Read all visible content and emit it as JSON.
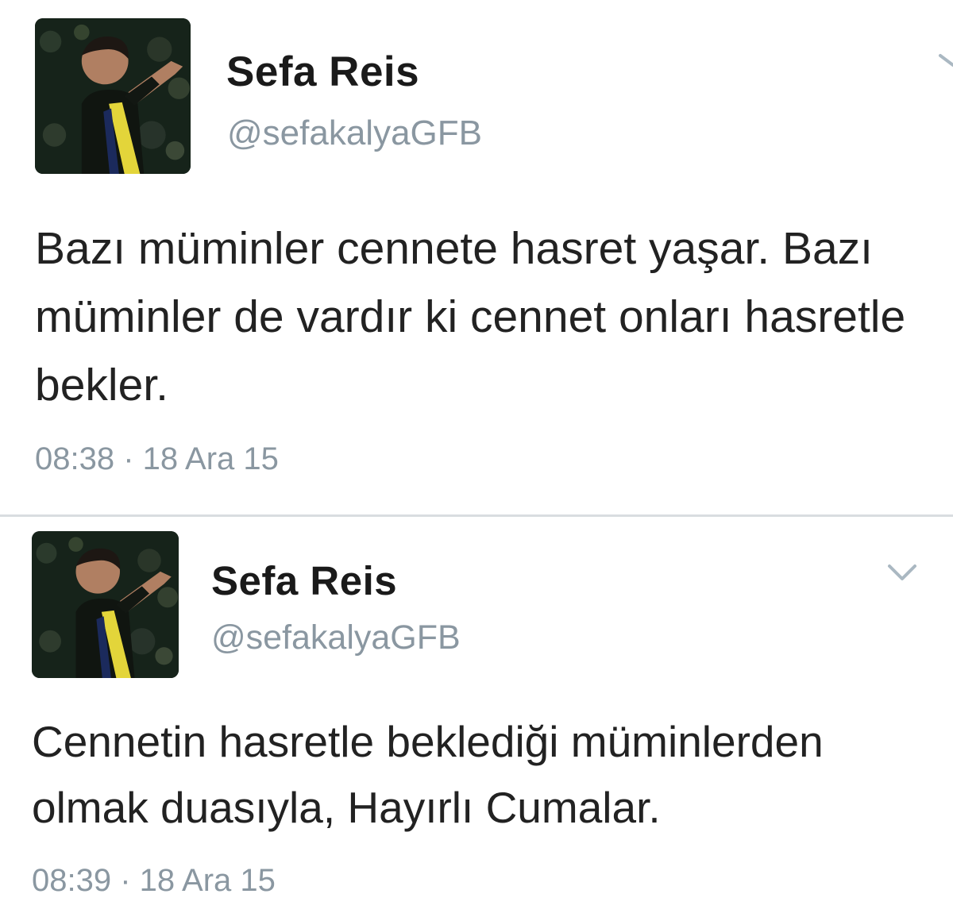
{
  "tweets": [
    {
      "display_name": "Sefa Reis",
      "handle": "@sefakalyaGFB",
      "text": "Bazı müminler cennete hasret yaşar. Bazı müminler de vardır ki cennet onları hasretle bekler.",
      "timestamp": "08:38 · 18 Ara 15"
    },
    {
      "display_name": "Sefa Reis",
      "handle": "@sefakalyaGFB",
      "text": "Cennetin hasretle beklediği müminlerden olmak duasıyla, Hayırlı Cumalar.",
      "timestamp": "08:39 · 18 Ara 15"
    }
  ],
  "icons": {
    "menu": "chevron-down-icon",
    "avatar": "profile-photo"
  },
  "colors": {
    "name": "#1a1a1a",
    "secondary_text": "#8a97a1",
    "body_text": "#222222",
    "divider": "#d9dde0",
    "chevron": "#aab8c2"
  }
}
